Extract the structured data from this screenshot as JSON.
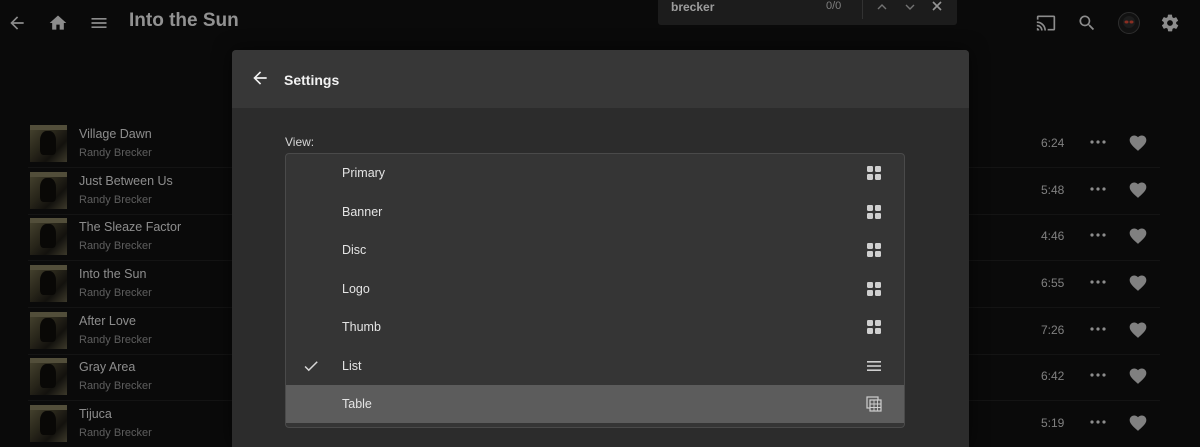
{
  "header": {
    "title": "Into the Sun"
  },
  "findbar": {
    "query": "brecker",
    "count": "0/0"
  },
  "tracks": [
    {
      "title": "Village Dawn",
      "artist": "Randy Brecker",
      "duration": "6:24"
    },
    {
      "title": "Just Between Us",
      "artist": "Randy Brecker",
      "duration": "5:48"
    },
    {
      "title": "The Sleaze Factor",
      "artist": "Randy Brecker",
      "duration": "4:46"
    },
    {
      "title": "Into the Sun",
      "artist": "Randy Brecker",
      "duration": "6:55"
    },
    {
      "title": "After Love",
      "artist": "Randy Brecker",
      "duration": "7:26"
    },
    {
      "title": "Gray Area",
      "artist": "Randy Brecker",
      "duration": "6:42"
    },
    {
      "title": "Tijuca",
      "artist": "Randy Brecker",
      "duration": "5:19"
    }
  ],
  "settings": {
    "title": "Settings",
    "view_label": "View:",
    "options": [
      {
        "label": "Primary",
        "icon": "grid-icon",
        "checked": false,
        "highlighted": false
      },
      {
        "label": "Banner",
        "icon": "grid-icon",
        "checked": false,
        "highlighted": false
      },
      {
        "label": "Disc",
        "icon": "grid-icon",
        "checked": false,
        "highlighted": false
      },
      {
        "label": "Logo",
        "icon": "grid-icon",
        "checked": false,
        "highlighted": false
      },
      {
        "label": "Thumb",
        "icon": "grid-icon",
        "checked": false,
        "highlighted": false
      },
      {
        "label": "List",
        "icon": "list-icon",
        "checked": true,
        "highlighted": false
      },
      {
        "label": "Table",
        "icon": "table-icon",
        "checked": false,
        "highlighted": true
      }
    ]
  },
  "colors": {
    "background": "#101010",
    "dialog": "#2c2c2c",
    "dialog_header": "#373737",
    "menu": "#353535",
    "highlight": "#5c5c5c"
  }
}
